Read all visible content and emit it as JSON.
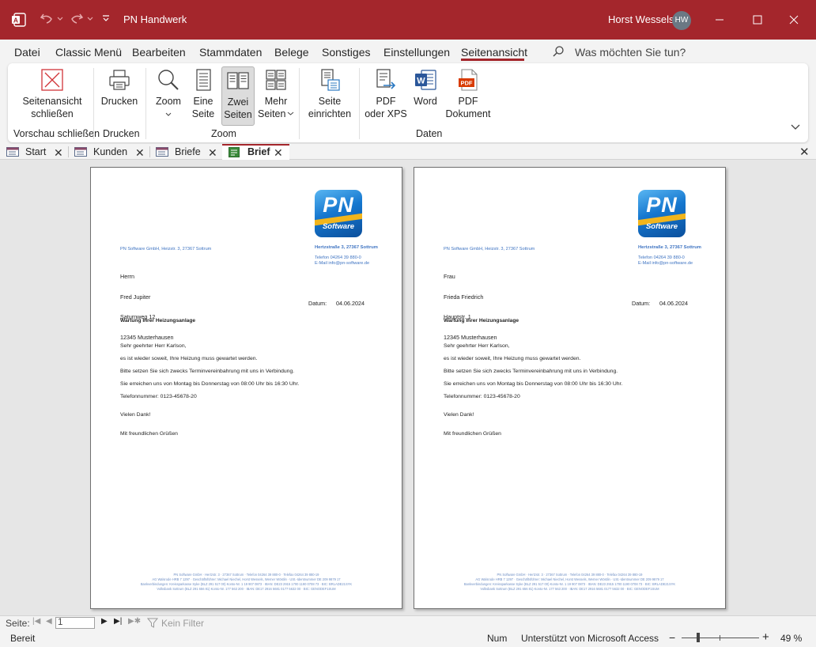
{
  "titlebar": {
    "title": "PN Handwerk",
    "user_name": "Horst Wessels",
    "user_initials": "HW"
  },
  "menu": {
    "items": [
      "Datei",
      "Classic Menü",
      "Bearbeiten",
      "Stammdaten",
      "Belege",
      "Sonstiges",
      "Einstellungen",
      "Seitenansicht"
    ],
    "active": "Seitenansicht",
    "search_placeholder": "Was möchten Sie tun?"
  },
  "ribbon": {
    "close_preview": {
      "line1": "Seitenansicht",
      "line2": "schließen"
    },
    "print": "Drucken",
    "zoom": "Zoom",
    "one_page": {
      "line1": "Eine",
      "line2": "Seite"
    },
    "two_pages": {
      "line1": "Zwei",
      "line2": "Seiten"
    },
    "more_pages": {
      "line1": "Mehr",
      "line2": "Seiten"
    },
    "page_setup": {
      "line1": "Seite",
      "line2": "einrichten"
    },
    "pdf_xps": {
      "line1": "PDF",
      "line2": "oder XPS"
    },
    "word": "Word",
    "pdf_doc": {
      "line1": "PDF",
      "line2": "Dokument"
    },
    "groups": {
      "close_preview": "Vorschau schließen",
      "print": "Drucken",
      "zoom": "Zoom",
      "data": "Daten"
    },
    "icon_colors": {
      "word": "#2b579a",
      "pdf": "#d83b01",
      "close": "#d13438"
    }
  },
  "tabs": [
    {
      "label": "Start",
      "active": false
    },
    {
      "label": "Kunden",
      "active": false
    },
    {
      "label": "Briefe",
      "active": false
    },
    {
      "label": "Brief",
      "active": true
    }
  ],
  "letters": [
    {
      "logo": {
        "pn": "PN",
        "software": "Software"
      },
      "sender_line": "PN Software GmbH, Heizstr. 3, 27367 Sottrum",
      "company_address": "Hertzstraße 3, 27367 Sottrum",
      "phone": "Telefon   04264 39 880-0",
      "email": "E-Mail    info@pn-software.de",
      "recipient": [
        "Herrn",
        "Fred Jupiter",
        "Saturnweg 12",
        "12345 Musterhausen"
      ],
      "date_label": "Datum:",
      "date": "04.06.2024",
      "subject": "Wartung Ihrer Heizungsanlage",
      "body": [
        "Sehr geehrter Herr Karlson,",
        "es ist wieder soweit, Ihre Heizung muss gewartet werden.",
        "Bitte setzen Sie sich zwecks Terminvereinbahrung mit uns in Verbindung.",
        "Sie erreichen uns von Montag bis Donnerstag von 08:00 Uhr bis 16:30 Uhr.",
        "Telefonnummer: 0123-45678-20",
        "Vielen Dank!",
        "Mit freundlichen Grüßen"
      ],
      "footer": [
        "PN Software GmbH · Hertzstr. 3 · 27367 Sottrum · Telefon 04264 39 880-0 · Telefax 04264 39 880-19",
        "AG Walsrode HRB 7 1297 · Geschäftsführer: Michael Niechel, Horst Wessels, Werner Wöstlin · USt.-Identnummer DE 209 9879 17",
        "Bankverbindungen: Kreissparkasse Syke (BLZ 291 517 00) Konto-Nr. 1 19 907 0873 · IBAN: DE23 2915 1700 1190 0708 73 · BIC: BRLADE21SYK",
        "Volksbank Sottrum (BLZ 291 656 81) Konto-Nr. 177 563 200 · IBAN: DE17 2916 5681 0177 5632 00 · BIC: GENODEF1SUM"
      ]
    },
    {
      "logo": {
        "pn": "PN",
        "software": "Software"
      },
      "sender_line": "PN Software GmbH, Heizstr. 3, 27367 Sottrum",
      "company_address": "Hertzstraße 3, 27367 Sottrum",
      "phone": "Telefon   04264 39 880-0",
      "email": "E-Mail    info@pn-software.de",
      "recipient": [
        "Frau",
        "Frieda Friedrich",
        "Hauptstr. 1",
        "12345 Musterhausen"
      ],
      "date_label": "Datum:",
      "date": "04.06.2024",
      "subject": "Wartung Ihrer Heizungsanlage",
      "body": [
        "Sehr geehrter Herr Karlson,",
        "es ist wieder soweit, Ihre Heizung muss gewartet werden.",
        "Bitte setzen Sie sich zwecks Terminvereinbahrung mit uns in Verbindung.",
        "Sie erreichen uns von Montag bis Donnerstag von 08:00 Uhr bis 16:30 Uhr.",
        "Telefonnummer: 0123-45678-20",
        "Vielen Dank!",
        "Mit freundlichen Grüßen"
      ],
      "footer": [
        "PN Software GmbH · Hertzstr. 3 · 27367 Sottrum · Telefon 04264 39 880-0 · Telefax 04264 39 880-19",
        "AG Walsrode HRB 7 1297 · Geschäftsführer: Michael Niechel, Horst Wessels, Werner Wöstlin · USt.-Identnummer DE 209 9879 17",
        "Bankverbindungen: Kreissparkasse Syke (BLZ 291 517 00) Konto-Nr. 1 19 907 0873 · IBAN: DE23 2915 1700 1190 0708 73 · BIC: BRLADE21SYK",
        "Volksbank Sottrum (BLZ 291 656 81) Konto-Nr. 177 563 200 · IBAN: DE17 2916 5681 0177 5632 00 · BIC: GENODEF1SUM"
      ]
    }
  ],
  "record_nav": {
    "label": "Seite:",
    "current_page": "1",
    "filter": "Kein Filter"
  },
  "statusbar": {
    "ready": "Bereit",
    "num": "Num",
    "supported": "Unterstützt von Microsoft Access",
    "zoom": "49 %",
    "zoom_fraction": 0.49
  },
  "colors": {
    "accent": "#a4262c",
    "letter_blue": "#3f74c2"
  }
}
